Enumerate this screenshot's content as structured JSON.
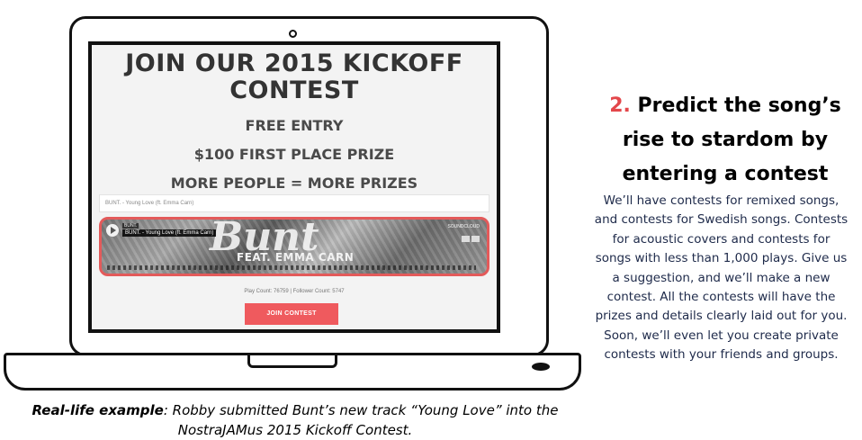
{
  "screen": {
    "title_line1": "JOIN OUR 2015 KICKOFF",
    "title_line2": "CONTEST",
    "promo_line1": "FREE ENTRY",
    "promo_line2": "$100 FIRST PLACE PRIZE",
    "promo_line3": "MORE PEOPLE = MORE PRIZES",
    "track_row_text": "BUNT. - Young Love (ft. Emma Carn)",
    "player": {
      "artist": "BUNT.",
      "song": "BUNT. - Young Love (ft. Emma Carn)",
      "art_brush_text": "Bunt",
      "art_feat_text": "FEAT. EMMA CARN",
      "source_label": "SOUNDCLOUD",
      "highlight_color": "#e35a5a"
    },
    "counts_text": "Play Count: 76759  |  Follower Count: 5747",
    "join_button_label": "JOIN CONTEST",
    "join_button_color": "#ef5a5e"
  },
  "caption": {
    "bold_part": "Real-life example",
    "rest_line1": ": Robby submitted Bunt’s new track “Young Love” into the",
    "line2": "NostraJAMus 2015 Kickoff Contest."
  },
  "right": {
    "step_number": "2.",
    "step_number_color": "#e3474b",
    "heading_line1": "Predict the song’s",
    "heading_line2": "rise to stardom by",
    "heading_line3": "entering a contest",
    "description_lines": [
      "We’ll have contests for remixed songs,",
      "and contests for Swedish songs. Contests",
      "for acoustic covers and contests for",
      "songs with less than 1,000 plays. Give us",
      "a suggestion, and we’ll make a new",
      "contest. All the contests will have the",
      "prizes and details clearly laid out for you.",
      "Soon, we’ll even let you create private",
      "contests with your friends and groups."
    ]
  }
}
